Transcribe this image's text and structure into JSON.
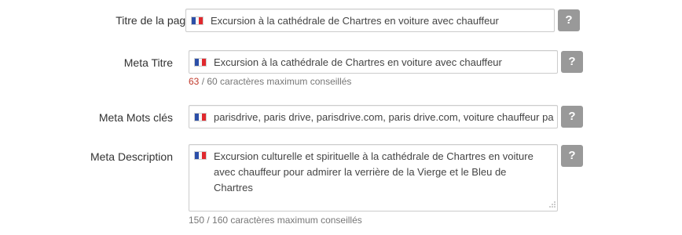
{
  "form": {
    "page_title": {
      "label": "Titre de la page",
      "value": "Excursion à la cathédrale de Chartres en voiture avec chauffeur",
      "help": "?"
    },
    "meta_title": {
      "label": "Meta Titre",
      "value": "Excursion à la cathédrale de Chartres en voiture avec chauffeur",
      "help": "?",
      "count": "63",
      "count_suffix": " / 60 caractères maximum conseillés"
    },
    "meta_keywords": {
      "label": "Meta Mots clés",
      "value": "parisdrive, paris drive, parisdrive.com, paris drive.com, voiture chauffeur pari",
      "help": "?"
    },
    "meta_description": {
      "label": "Meta Description",
      "value": "Excursion culturelle et spirituelle à la cathédrale de Chartres en voiture avec chauffeur pour admirer la verrière de la Vierge et le Bleu de Chartres",
      "help": "?",
      "count_text": "150 / 160 caractères maximum conseillés"
    }
  },
  "language_flag": "fr-flag-icon",
  "colors": {
    "over_limit": "#c0392b",
    "help_button": "#999999"
  }
}
